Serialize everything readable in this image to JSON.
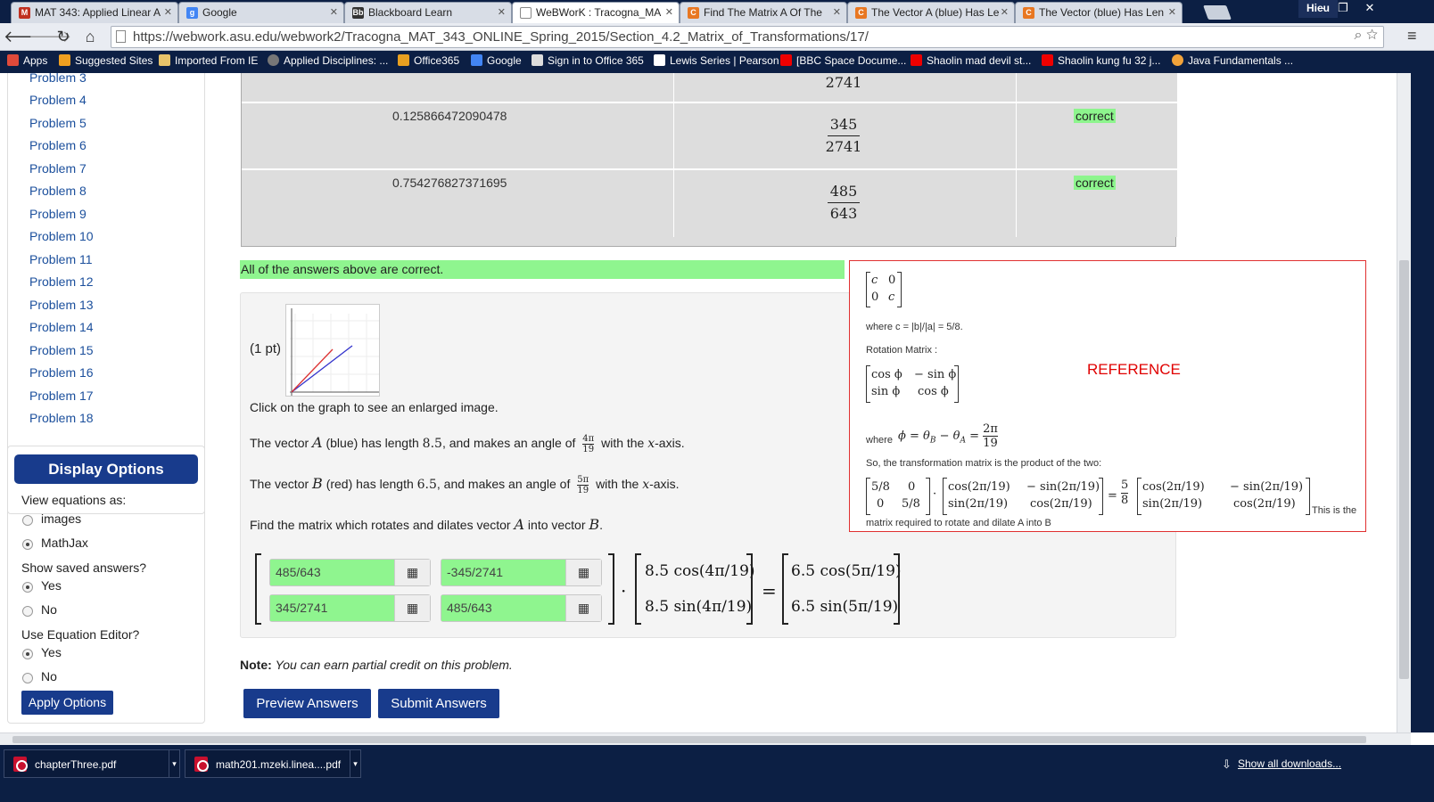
{
  "browser": {
    "tabs": [
      {
        "title": "MAT 343: Applied Linear A",
        "favicon": "gmail",
        "color": "#c03020"
      },
      {
        "title": "Google",
        "favicon": "google",
        "color": "#4285f4"
      },
      {
        "title": "Blackboard Learn",
        "favicon": "blackboard",
        "color": "#333333"
      },
      {
        "title": "WeBWorK : Tracogna_MA",
        "favicon": "page",
        "color": "#888888"
      },
      {
        "title": "Find The Matrix A Of The",
        "favicon": "chegg",
        "color": "#e87722"
      },
      {
        "title": "The Vector A (blue) Has Le",
        "favicon": "chegg",
        "color": "#e87722"
      },
      {
        "title": "The Vector (blue) Has Len",
        "favicon": "chegg",
        "color": "#e87722"
      }
    ],
    "user": "Hieu",
    "url": "https://webwork.asu.edu/webwork2/Tracogna_MAT_343_ONLINE_Spring_2015/Section_4.2_Matrix_of_Transformations/17/",
    "bookmarks": [
      "Apps",
      "Suggested Sites",
      "Imported From IE",
      "Applied Disciplines: ...",
      "Office365",
      "Google",
      "Sign in to Office 365",
      "Lewis Series | Pearson",
      "[BBC Space Docume...",
      "Shaolin mad devil st...",
      "Shaolin kung fu 32 j...",
      "Java Fundamentals ..."
    ]
  },
  "sidebar": {
    "problems": [
      "Problem 3",
      "Problem 4",
      "Problem 5",
      "Problem 6",
      "Problem 7",
      "Problem 8",
      "Problem 9",
      "Problem 10",
      "Problem 11",
      "Problem 12",
      "Problem 13",
      "Problem 14",
      "Problem 15",
      "Problem 16",
      "Problem 17",
      "Problem 18"
    ],
    "display_options": {
      "title": "Display Options",
      "view_label": "View equations as:",
      "view_options": [
        "images",
        "MathJax"
      ],
      "view_selected": "MathJax",
      "saved_label": "Show saved answers?",
      "saved_options": [
        "Yes",
        "No"
      ],
      "saved_selected": "Yes",
      "editor_label": "Use Equation Editor?",
      "editor_options": [
        "Yes",
        "No"
      ],
      "editor_selected": "Yes",
      "apply_label": "Apply Options"
    }
  },
  "results": {
    "rows": [
      {
        "entered": "",
        "preview_num": "",
        "preview_den": "2741",
        "result": ""
      },
      {
        "entered": "0.125866472090478",
        "preview_num": "345",
        "preview_den": "2741",
        "result": "correct"
      },
      {
        "entered": "0.754276827371695",
        "preview_num": "485",
        "preview_den": "643",
        "result": "correct"
      }
    ],
    "summary": "All of the answers above are correct."
  },
  "problem": {
    "points": "(1 pt)",
    "graph_caption": "Click on the graph to see an enlarged image.",
    "line_a_pre": "The vector",
    "line_a_var": "A",
    "line_a_mid": "(blue) has length",
    "line_a_len": "8.5",
    "line_a_post": ", and makes an angle of",
    "line_a_angle_num": "4π",
    "line_a_angle_den": "19",
    "line_a_end": "with the",
    "axis_var": "x",
    "axis_end": "-axis.",
    "line_b_pre": "The vector",
    "line_b_var": "B",
    "line_b_mid": "(red) has length",
    "line_b_len": "6.5",
    "line_b_post": ", and makes an angle of",
    "line_b_angle_num": "5π",
    "line_b_angle_den": "19",
    "line_b_end": "with the",
    "find_pre": "Find the matrix which rotates and dilates vector",
    "find_a": "A",
    "find_mid": "into vector",
    "find_b": "B",
    "find_end": ".",
    "answers": [
      "485/643",
      "-345/2741",
      "345/2741",
      "485/643"
    ],
    "vec_a": [
      "8.5 cos(4π/19)",
      "8.5 sin(4π/19)"
    ],
    "vec_b": [
      "6.5 cos(5π/19)",
      "6.5 sin(5π/19)"
    ],
    "dot": "·",
    "equals": "=",
    "note_label": "Note:",
    "note_text": "You can earn partial credit on this problem.",
    "preview_label": "Preview Answers",
    "submit_label": "Submit Answers"
  },
  "reference": {
    "label": "REFERENCE",
    "dilation_matrix": [
      [
        "c",
        "0"
      ],
      [
        "0",
        "c"
      ]
    ],
    "where_c": "where c = |b|/|a| = 5/8.",
    "rotation_title": "Rotation Matrix :",
    "rotation_matrix": [
      [
        "cos ϕ",
        "− sin ϕ"
      ],
      [
        "sin ϕ",
        "cos ϕ"
      ]
    ],
    "where_label": "where",
    "phi_eq": "ϕ = θ",
    "phi_sub_b": "B",
    "phi_minus": " − θ",
    "phi_sub_a": "A",
    "phi_eq2": " = ",
    "phi_num": "2π",
    "phi_den": "19",
    "so_text": "So, the transformation matrix is the product of the two:",
    "dil_num": [
      [
        "5/8",
        "0"
      ],
      [
        "0",
        "5/8"
      ]
    ],
    "rot_num": [
      [
        "cos(2π/19)",
        "− sin(2π/19)"
      ],
      [
        "sin(2π/19)",
        "cos(2π/19)"
      ]
    ],
    "scalar_num": "5",
    "scalar_den": "8",
    "rot_num2": [
      [
        "cos(2π/19)",
        "− sin(2π/19)"
      ],
      [
        "sin(2π/19)",
        "cos(2π/19)"
      ]
    ],
    "tail_a": "This is the",
    "tail_b": "matrix required to rotate and dilate A into B"
  },
  "downloads": {
    "items": [
      "chapterThree.pdf",
      "math201.mzeki.linea....pdf"
    ],
    "show_all": "Show all downloads..."
  },
  "colors": {
    "correct_green": "#8ff58f",
    "button_blue": "#183b8c",
    "reference_red": "#e00000",
    "vector_blue": "#3333cc",
    "vector_red": "#dd3333"
  }
}
